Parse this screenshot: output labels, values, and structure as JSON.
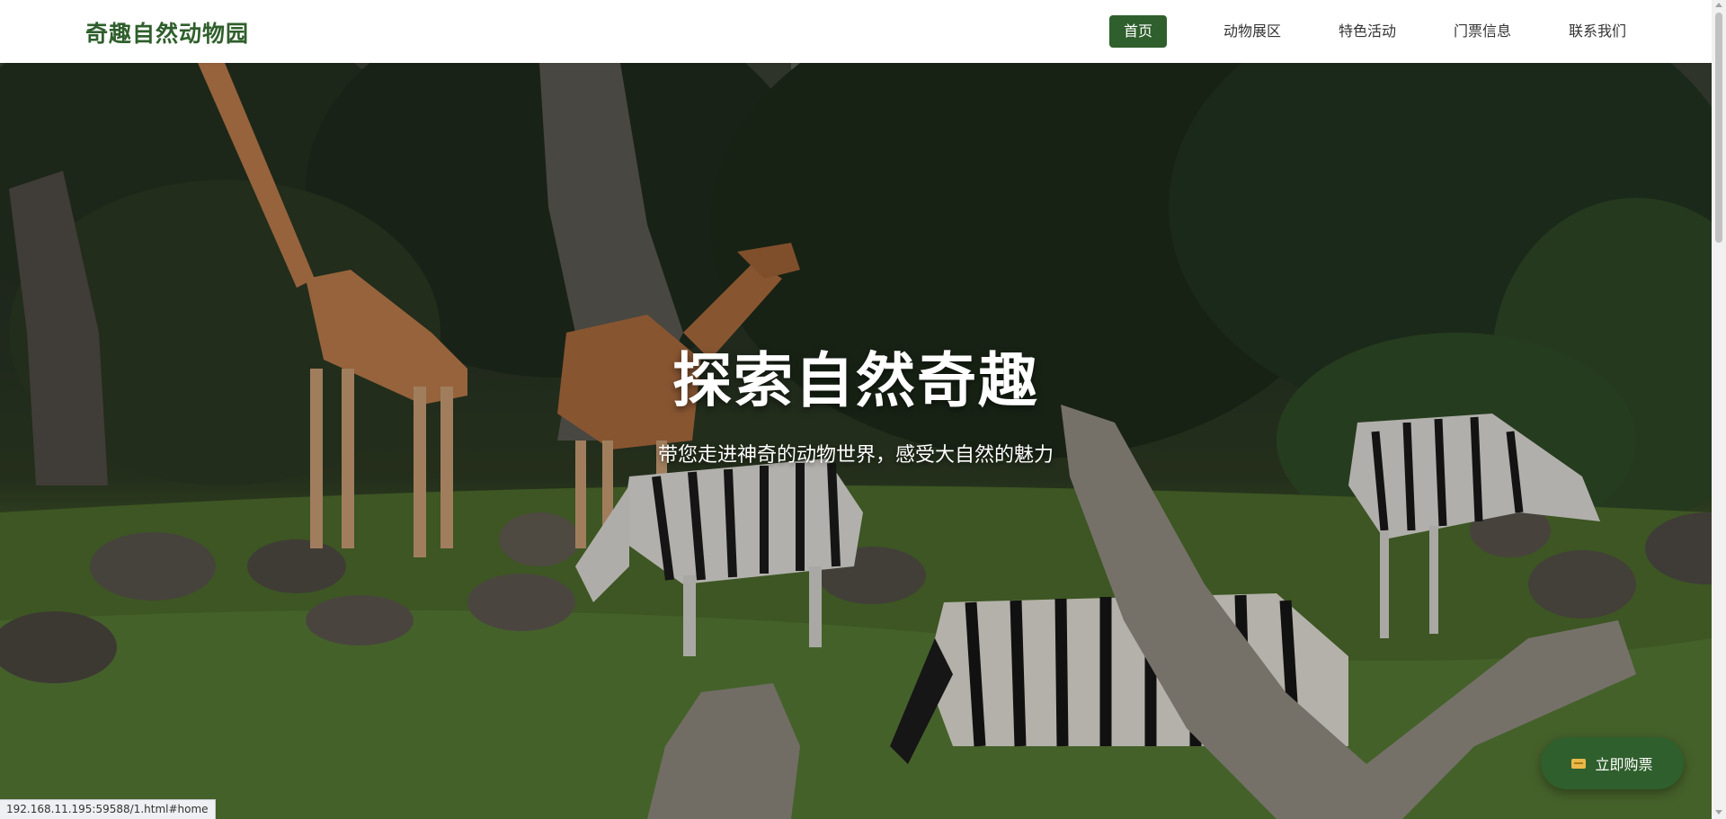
{
  "header": {
    "logo": "奇趣自然动物园",
    "nav": [
      {
        "label": "首页",
        "active": true
      },
      {
        "label": "动物展区",
        "active": false
      },
      {
        "label": "特色活动",
        "active": false
      },
      {
        "label": "门票信息",
        "active": false
      },
      {
        "label": "联系我们",
        "active": false
      }
    ]
  },
  "hero": {
    "title": "探索自然奇趣",
    "subtitle": "带您走进神奇的动物世界，感受大自然的魅力",
    "scene_subjects": [
      "giraffe",
      "giraffe",
      "zebra",
      "zebra",
      "zebra",
      "trees",
      "rocks",
      "driftwood"
    ]
  },
  "floating": {
    "buy_label": "立即购票",
    "icon": "ticket-icon"
  },
  "status_bar": {
    "url": "192.168.11.195:59588/1.html#home"
  },
  "colors": {
    "brand_green": "#2f5f2c",
    "nav_text": "#333333",
    "hero_text": "#ffffff"
  }
}
